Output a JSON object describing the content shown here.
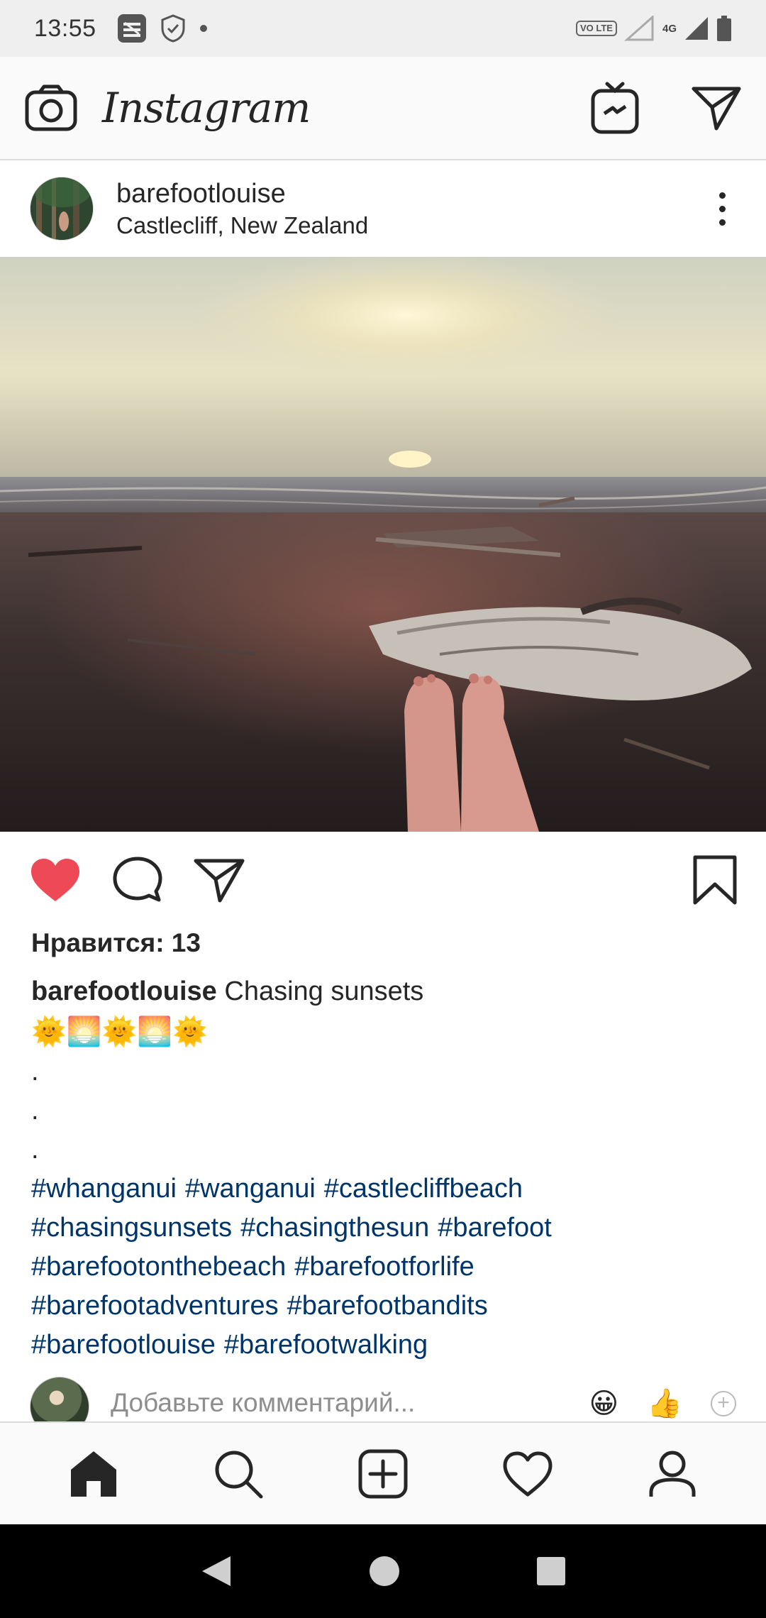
{
  "status_bar": {
    "time": "13:55",
    "lte_label": "VO LTE",
    "network_label": "4G"
  },
  "app": {
    "brand": "Instagram"
  },
  "post": {
    "username": "barefootlouise",
    "location": "Castlecliff, New Zealand",
    "liked": true,
    "likes_text": "Нравится: 13",
    "caption_user": "barefootlouise",
    "caption_text": "Chasing sunsets",
    "caption_emojis": "🌞🌅🌞🌅🌞",
    "dots": [
      ".",
      ".",
      "."
    ],
    "hashtag_lines": [
      [
        "#whanganui",
        "#wanganui",
        "#castlecliffbeach"
      ],
      [
        "#chasingsunsets",
        "#chasingthesun",
        "#barefoot"
      ],
      [
        "#barefootonthebeach",
        "#barefootforlife"
      ],
      [
        "#barefootadventures",
        "#barefootbandits"
      ],
      [
        "#barefootlouise",
        "#barefootwalking"
      ]
    ]
  },
  "comment": {
    "placeholder": "Добавьте комментарий...",
    "quick_emojis": [
      "😀",
      "👍"
    ]
  },
  "colors": {
    "like_red": "#ed4956",
    "hashtag_blue": "#003569",
    "text_dark": "#262626",
    "muted_gray": "#8e8e8e"
  },
  "icons": {
    "top_bar": [
      "camera-icon",
      "igtv-icon",
      "direct-message-icon"
    ],
    "post_actions": [
      "heart-filled-icon",
      "comment-icon",
      "share-icon",
      "bookmark-icon"
    ],
    "bottom_nav": [
      "home-icon",
      "search-icon",
      "add-post-icon",
      "activity-heart-icon",
      "profile-icon"
    ],
    "system_nav": [
      "back-icon",
      "home-circle-icon",
      "recents-icon"
    ]
  }
}
